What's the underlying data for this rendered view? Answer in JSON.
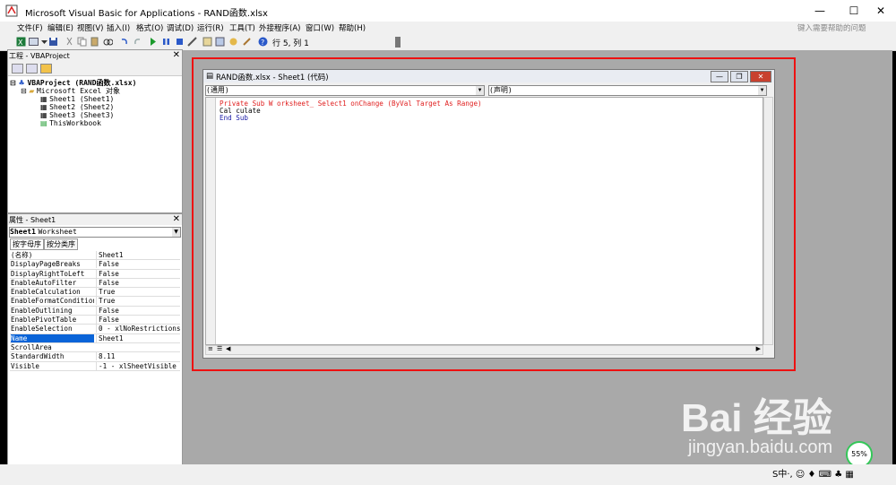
{
  "window": {
    "title": "Microsoft Visual Basic for Applications - RAND函数.xlsx"
  },
  "menu": {
    "items": [
      "文件(F)",
      "编辑(E)",
      "视图(V)",
      "插入(I)",
      "格式(O)",
      "调试(D)",
      "运行(R)",
      "工具(T)",
      "外接程序(A)",
      "窗口(W)",
      "帮助(H)"
    ],
    "search_placeholder": "键入需要帮助的问题"
  },
  "toolbar": {
    "position_text": "行 5, 列 1"
  },
  "project_panel": {
    "title": "工程 - VBAProject",
    "tree": [
      {
        "label": "VBAProject (RAND函数.xlsx)",
        "level": 0,
        "icon": "project-icon"
      },
      {
        "label": "Microsoft Excel 对象",
        "level": 1,
        "icon": "folder-icon"
      },
      {
        "label": "Sheet1 (Sheet1)",
        "level": 2,
        "icon": "sheet-icon"
      },
      {
        "label": "Sheet2 (Sheet2)",
        "level": 2,
        "icon": "sheet-icon"
      },
      {
        "label": "Sheet3 (Sheet3)",
        "level": 2,
        "icon": "sheet-icon"
      },
      {
        "label": "ThisWorkbook",
        "level": 2,
        "icon": "workbook-icon"
      }
    ]
  },
  "properties_panel": {
    "title": "属性 - Sheet1",
    "object_name": "Sheet1",
    "object_type": "Worksheet",
    "tabs": [
      "按字母序",
      "按分类序"
    ],
    "rows": [
      {
        "name": "(名称)",
        "value": "Sheet1"
      },
      {
        "name": "DisplayPageBreaks",
        "value": "False"
      },
      {
        "name": "DisplayRightToLeft",
        "value": "False"
      },
      {
        "name": "EnableAutoFilter",
        "value": "False"
      },
      {
        "name": "EnableCalculation",
        "value": "True"
      },
      {
        "name": "EnableFormatConditions",
        "value": "True"
      },
      {
        "name": "EnableOutlining",
        "value": "False"
      },
      {
        "name": "EnablePivotTable",
        "value": "False"
      },
      {
        "name": "EnableSelection",
        "value": "0 - xlNoRestrictions"
      },
      {
        "name": "Name",
        "value": "Sheet1",
        "selected": true
      },
      {
        "name": "ScrollArea",
        "value": ""
      },
      {
        "name": "StandardWidth",
        "value": "8.11"
      },
      {
        "name": "Visible",
        "value": "-1 - xlSheetVisible"
      }
    ]
  },
  "code_window": {
    "title": "RAND函数.xlsx - Sheet1 (代码)",
    "object_combo": "(通用)",
    "proc_combo": "(声明)",
    "lines": [
      {
        "text": "Private Sub W orksheet_ Select1 onChange (ByVal Target As Range)",
        "color": "#e02020"
      },
      {
        "text": "Cal culate",
        "color": "#000000"
      },
      {
        "text": "End Sub",
        "color": "#1a1aa6"
      }
    ]
  },
  "overlay": {
    "watermark_brand": "Bai  经验",
    "watermark_url": "jingyan.baidu.com",
    "gauge_value": "55%",
    "tray_text": "S中·, ☺ ♦ ⌨ ♣ ▦"
  },
  "colors": {
    "highlight": "#e11111",
    "selection": "#0a64d8"
  }
}
